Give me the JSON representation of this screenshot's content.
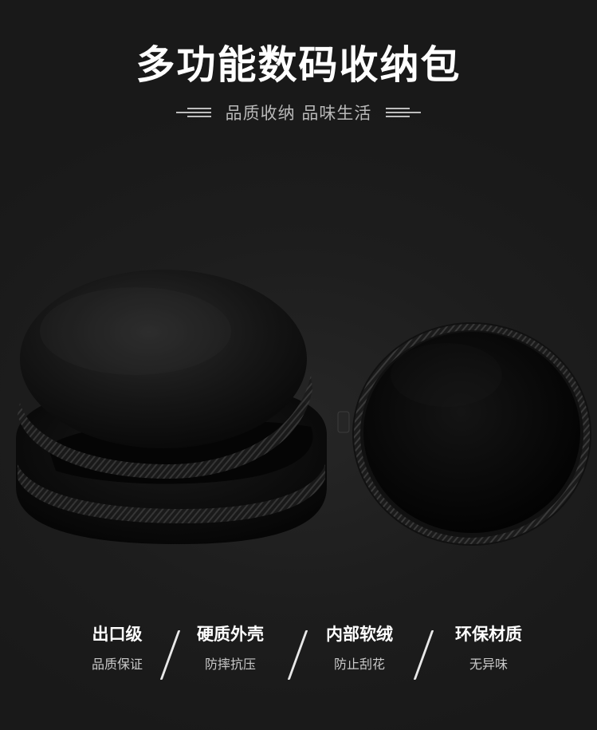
{
  "title": "多功能数码收纳包",
  "subtitle": "品质收纳 品味生活",
  "features": [
    {
      "title": "出口级",
      "sub": "品质保证"
    },
    {
      "title": "硬质外壳",
      "sub": "防摔抗压"
    },
    {
      "title": "内部软绒",
      "sub": "防止刮花"
    },
    {
      "title": "环保材质",
      "sub": "无异味"
    }
  ],
  "colors": {
    "background": "#1c1c1c",
    "case": "#0a0a0a",
    "zipper": "#2a2a2a",
    "text": "#ffffff",
    "subtext": "#b9b9b9"
  }
}
